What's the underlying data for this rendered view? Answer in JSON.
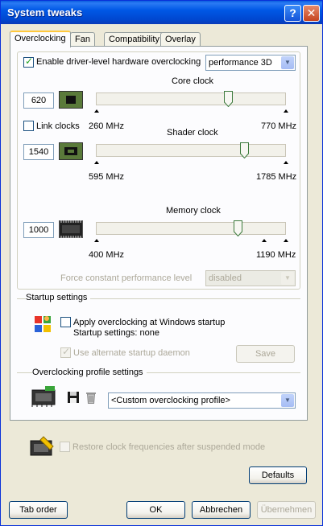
{
  "window": {
    "title": "System tweaks"
  },
  "tabs": [
    "Overclocking",
    "Fan",
    "Compatibility",
    "Overlay"
  ],
  "overclocking": {
    "enable_label": "Enable driver-level hardware overclocking",
    "enable_checked": true,
    "mode_value": "performance 3D",
    "core": {
      "title": "Core clock",
      "value": "620",
      "min": "260 MHz",
      "max": "770 MHz",
      "fraction": 0.706
    },
    "link_clocks_label": "Link clocks",
    "link_clocks_checked": false,
    "shader": {
      "title": "Shader clock",
      "value": "1540",
      "min": "595 MHz",
      "max": "1785 MHz",
      "fraction": 0.794
    },
    "memory": {
      "title": "Memory clock",
      "value": "1000",
      "min": "400 MHz",
      "max": "1190 MHz",
      "fraction": 0.759
    },
    "force_perf_label": "Force constant performance level",
    "force_perf_value": "disabled"
  },
  "startup": {
    "group_title": "Startup settings",
    "apply_label": "Apply overclocking at Windows startup",
    "apply_checked": false,
    "status_text": "Startup settings: none",
    "daemon_label": "Use alternate startup daemon",
    "save_label": "Save"
  },
  "profile": {
    "group_title": "Overclocking profile settings",
    "selected": "<Custom overclocking profile>"
  },
  "restore_label": "Restore clock frequencies after suspended mode",
  "buttons": {
    "defaults": "Defaults",
    "tab_order": "Tab order",
    "ok": "OK",
    "cancel": "Abbrechen",
    "apply": "Übernehmen"
  }
}
